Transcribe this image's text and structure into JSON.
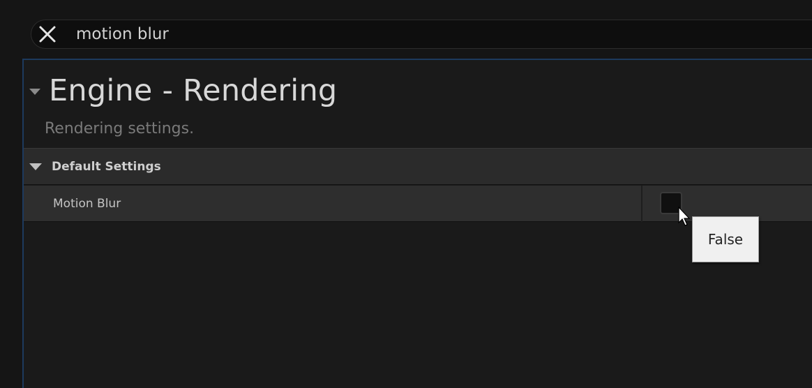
{
  "search": {
    "value": "motion blur",
    "clear_icon": "close-icon"
  },
  "category": {
    "title": "Engine - Rendering",
    "description": "Rendering settings."
  },
  "section": {
    "label": "Default Settings",
    "expanded": true
  },
  "settings": [
    {
      "label": "Motion Blur",
      "checked": false
    }
  ],
  "tooltip": {
    "text": "False"
  },
  "colors": {
    "background": "#151515",
    "panel_border": "#1d3a5e",
    "section_header": "#2b2b2b",
    "row": "#2e2e2e"
  }
}
